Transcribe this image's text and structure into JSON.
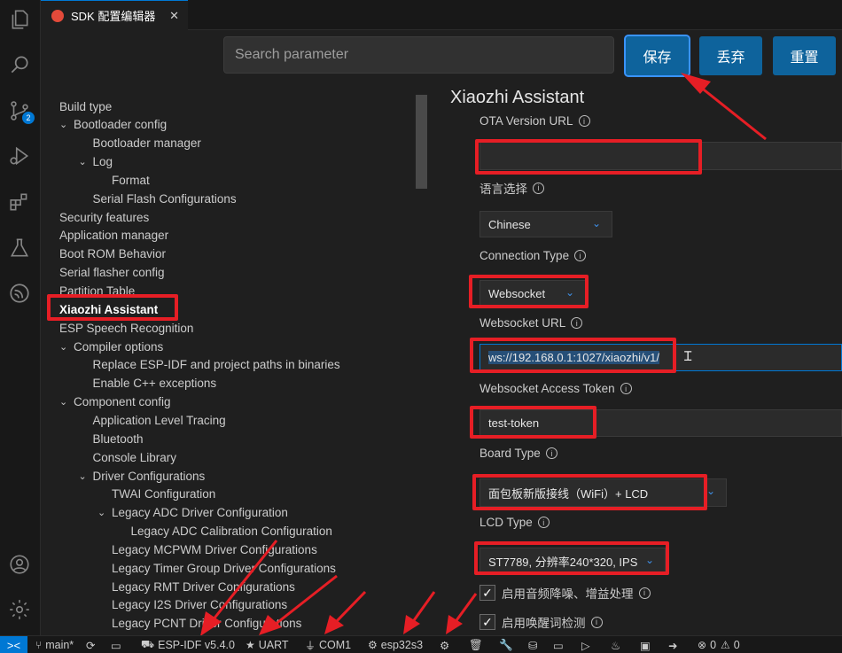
{
  "tab": {
    "title": "SDK 配置编辑器",
    "close": "✕"
  },
  "search": {
    "placeholder": "Search parameter"
  },
  "buttons": {
    "save": "保存",
    "discard": "丢弃",
    "reset": "重置"
  },
  "activity": {
    "scm_badge": "2"
  },
  "tree": [
    {
      "label": "Build type",
      "level": 0,
      "chevron": ""
    },
    {
      "label": "Bootloader config",
      "level": 0,
      "chevron": "⌄"
    },
    {
      "label": "Bootloader manager",
      "level": 1,
      "chevron": ""
    },
    {
      "label": "Log",
      "level": 1,
      "chevron": "⌄"
    },
    {
      "label": "Format",
      "level": 2,
      "chevron": ""
    },
    {
      "label": "Serial Flash Configurations",
      "level": 1,
      "chevron": ""
    },
    {
      "label": "Security features",
      "level": 0,
      "chevron": ""
    },
    {
      "label": "Application manager",
      "level": 0,
      "chevron": ""
    },
    {
      "label": "Boot ROM Behavior",
      "level": 0,
      "chevron": ""
    },
    {
      "label": "Serial flasher config",
      "level": 0,
      "chevron": ""
    },
    {
      "label": "Partition Table",
      "level": 0,
      "chevron": ""
    },
    {
      "label": "Xiaozhi Assistant",
      "level": 0,
      "chevron": "",
      "selected": true
    },
    {
      "label": "ESP Speech Recognition",
      "level": 0,
      "chevron": ""
    },
    {
      "label": "Compiler options",
      "level": 0,
      "chevron": "⌄"
    },
    {
      "label": "Replace ESP-IDF and project paths in binaries",
      "level": 1,
      "chevron": ""
    },
    {
      "label": "Enable C++ exceptions",
      "level": 1,
      "chevron": ""
    },
    {
      "label": "Component config",
      "level": 0,
      "chevron": "⌄"
    },
    {
      "label": "Application Level Tracing",
      "level": 1,
      "chevron": ""
    },
    {
      "label": "Bluetooth",
      "level": 1,
      "chevron": ""
    },
    {
      "label": "Console Library",
      "level": 1,
      "chevron": ""
    },
    {
      "label": "Driver Configurations",
      "level": 1,
      "chevron": "⌄"
    },
    {
      "label": "TWAI Configuration",
      "level": 2,
      "chevron": ""
    },
    {
      "label": "Legacy ADC Driver Configuration",
      "level": 2,
      "chevron": "⌄"
    },
    {
      "label": "Legacy ADC Calibration Configuration",
      "level": 3,
      "chevron": ""
    },
    {
      "label": "Legacy MCPWM Driver Configurations",
      "level": 2,
      "chevron": ""
    },
    {
      "label": "Legacy Timer Group Driver Configurations",
      "level": 2,
      "chevron": ""
    },
    {
      "label": "Legacy RMT Driver Configurations",
      "level": 2,
      "chevron": ""
    },
    {
      "label": "Legacy I2S Driver Configurations",
      "level": 2,
      "chevron": ""
    },
    {
      "label": "Legacy PCNT Driver Configurations",
      "level": 2,
      "chevron": ""
    }
  ],
  "panel": {
    "title": "Xiaozhi Assistant",
    "ota_label": "OTA Version URL",
    "ota_value": "",
    "lang_label": "语言选择",
    "lang_value": "Chinese",
    "conn_label": "Connection Type",
    "conn_value": "Websocket",
    "ws_url_label": "Websocket URL",
    "ws_url_selected": "ws://192.168.0.1:1027/xiaozhi/v1/",
    "ws_token_label": "Websocket Access Token",
    "ws_token_value": "test-token",
    "board_label": "Board Type",
    "board_value": "面包板新版接线（WiFi）+ LCD",
    "lcd_label": "LCD Type",
    "lcd_value": "ST7789, 分辨率240*320, IPS",
    "check1": "启用音频降噪、增益处理",
    "check2": "启用唤醒词检测",
    "info_glyph": "i"
  },
  "status": {
    "remote": "><",
    "branch": "main*",
    "idf": "ESP-IDF v5.4.0",
    "uart": "UART",
    "com": "COM1",
    "target": "esp32s3",
    "problems_errors": "0",
    "problems_warnings": "0"
  },
  "colors": {
    "accent": "#0078d4",
    "button": "#0e639c",
    "highlight": "#e61e25"
  }
}
